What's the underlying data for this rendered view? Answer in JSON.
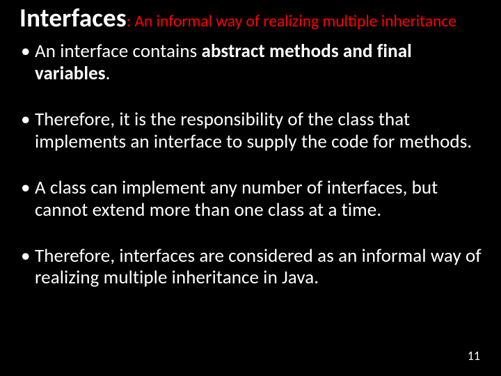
{
  "title": {
    "main": "Interfaces",
    "sep": ": ",
    "sub": "An informal way of realizing multiple inheritance"
  },
  "bullets": [
    {
      "pre": "An interface contains ",
      "bold": "abstract methods and final variables",
      "post": "."
    },
    {
      "pre": "Therefore, it is the responsibility of the class that implements an interface to supply the code for methods.",
      "bold": "",
      "post": ""
    },
    {
      "pre": "A class can implement any number of interfaces, but cannot extend more than one class at a time.",
      "bold": "",
      "post": ""
    },
    {
      "pre": "Therefore, interfaces are considered as an informal way of realizing multiple inheritance in Java.",
      "bold": "",
      "post": ""
    }
  ],
  "page_number": "11"
}
